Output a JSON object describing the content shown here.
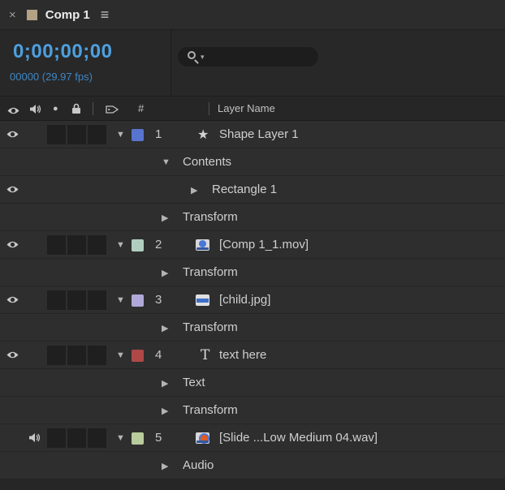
{
  "tab": {
    "title": "Comp 1"
  },
  "time": {
    "timecode": "0;00;00;00",
    "frames": "00000 (29.97 fps)"
  },
  "search": {
    "value": ""
  },
  "header": {
    "number": "#",
    "layer_name": "Layer Name"
  },
  "icons": {
    "close": "×",
    "menu": "≡",
    "solo": "●",
    "search_dropdown": "▾",
    "twirl_open": "▼",
    "twirl_closed": "▶",
    "star": "★",
    "text_layer": "T"
  },
  "colors": {
    "timecode_blue": "#4da0e0",
    "frames_blue": "#3f86c4"
  },
  "rows": [
    {
      "kind": "layer",
      "av": "eye",
      "expanded": true,
      "color": "#5874cf",
      "num": "1",
      "icon": "star",
      "label": "Shape Layer 1"
    },
    {
      "kind": "group",
      "indent": 2,
      "av": "",
      "expanded": true,
      "label": "Contents"
    },
    {
      "kind": "group",
      "indent": 3,
      "av": "eye",
      "expanded": false,
      "label": "Rectangle 1"
    },
    {
      "kind": "group",
      "indent": 2,
      "av": "",
      "expanded": false,
      "label": "Transform"
    },
    {
      "kind": "layer",
      "av": "eye",
      "expanded": true,
      "color": "#b0cec0",
      "num": "2",
      "icon": "mov",
      "label": "[Comp 1_1.mov]"
    },
    {
      "kind": "group",
      "indent": 2,
      "av": "",
      "expanded": false,
      "label": "Transform"
    },
    {
      "kind": "layer",
      "av": "eye",
      "expanded": true,
      "color": "#b0a8d8",
      "num": "3",
      "icon": "jpg",
      "label": "[child.jpg]"
    },
    {
      "kind": "group",
      "indent": 2,
      "av": "",
      "expanded": false,
      "label": "Transform"
    },
    {
      "kind": "layer",
      "av": "eye",
      "expanded": true,
      "color": "#b04848",
      "num": "4",
      "icon": "text",
      "label": "text here"
    },
    {
      "kind": "group",
      "indent": 2,
      "av": "",
      "expanded": false,
      "label": "Text"
    },
    {
      "kind": "group",
      "indent": 2,
      "av": "",
      "expanded": false,
      "label": "Transform"
    },
    {
      "kind": "layer",
      "av": "speaker",
      "expanded": true,
      "color": "#b8cc9c",
      "num": "5",
      "icon": "wav",
      "label": "[Slide ...Low Medium 04.wav]"
    },
    {
      "kind": "group",
      "indent": 2,
      "av": "",
      "expanded": false,
      "label": "Audio"
    }
  ]
}
